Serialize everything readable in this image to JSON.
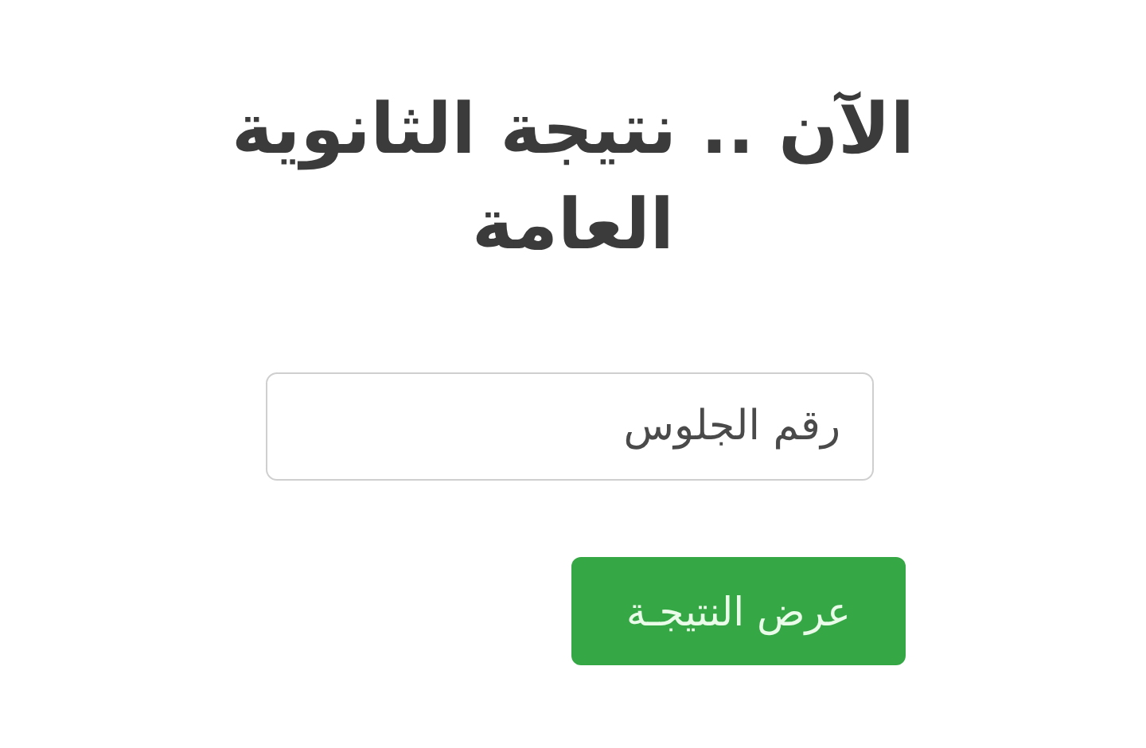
{
  "heading": "الآن .. نتيجة الثانوية العامة",
  "seat_number_field": {
    "placeholder": "رقم الجلوس"
  },
  "submit_button": {
    "label": "عرض النتيجـة"
  }
}
